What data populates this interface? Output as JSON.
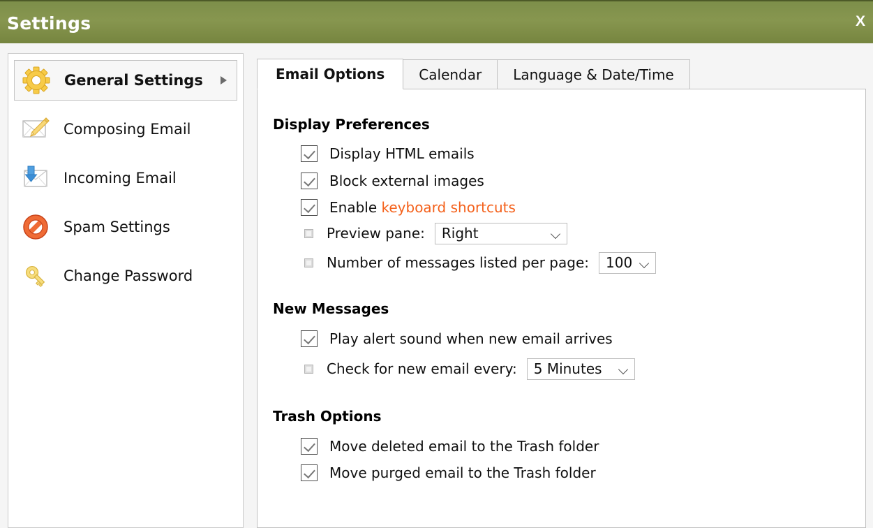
{
  "window": {
    "title": "Settings",
    "close_label": "X",
    "header_color": "#7f8e4c"
  },
  "sidebar": {
    "items": [
      {
        "label": "General Settings",
        "icon": "gear-icon",
        "selected": true,
        "has_arrow": true
      },
      {
        "label": "Composing Email",
        "icon": "envelope-pencil-icon",
        "selected": false,
        "has_arrow": false
      },
      {
        "label": "Incoming Email",
        "icon": "envelope-download-icon",
        "selected": false,
        "has_arrow": false
      },
      {
        "label": "Spam Settings",
        "icon": "no-entry-icon",
        "selected": false,
        "has_arrow": false
      },
      {
        "label": "Change Password",
        "icon": "key-icon",
        "selected": false,
        "has_arrow": false
      }
    ]
  },
  "tabs": [
    {
      "label": "Email Options",
      "active": true
    },
    {
      "label": "Calendar",
      "active": false
    },
    {
      "label": "Language & Date/Time",
      "active": false
    }
  ],
  "sections": {
    "display": {
      "title": "Display Preferences",
      "opt_html": "Display HTML emails",
      "opt_block": "Block external images",
      "opt_enable_prefix": "Enable ",
      "opt_enable_link": "keyboard shortcuts",
      "preview_label": "Preview pane:",
      "preview_value": "Right",
      "perpage_label": "Number of messages listed per page:",
      "perpage_value": "100"
    },
    "new_messages": {
      "title": "New Messages",
      "opt_alert": "Play alert sound when new email arrives",
      "check_label": "Check for new email every:",
      "check_value": "5 Minutes"
    },
    "trash": {
      "title": "Trash Options",
      "opt_deleted": "Move deleted email to the Trash folder",
      "opt_purged": "Move purged email to the Trash folder"
    }
  },
  "colors": {
    "accent_link": "#f4611b",
    "header_green": "#7f8e4c",
    "gear_yellow": "#f4c430"
  }
}
